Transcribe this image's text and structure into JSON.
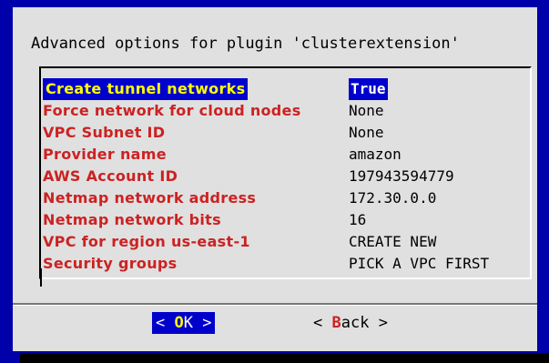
{
  "dialog": {
    "title": "Advanced options for plugin 'clusterextension'"
  },
  "options": [
    {
      "key": "Create tunnel networks",
      "value": "True",
      "selected": true
    },
    {
      "key": "Force network for cloud nodes",
      "value": "None"
    },
    {
      "key": "VPC Subnet ID",
      "value": "None"
    },
    {
      "key": "Provider name",
      "value": "amazon"
    },
    {
      "key": "AWS Account ID",
      "value": "197943594779"
    },
    {
      "key": "Netmap network address",
      "value": "172.30.0.0"
    },
    {
      "key": "Netmap network bits",
      "value": "16"
    },
    {
      "key": "VPC for region us-east-1",
      "value": "CREATE NEW"
    },
    {
      "key": "Security groups",
      "value": "PICK A VPC FIRST"
    }
  ],
  "buttons": {
    "ok": {
      "left": "< ",
      "hot": "O",
      "rest": "K",
      "right": " >"
    },
    "back": {
      "left": "< ",
      "hot": "B",
      "rest": "ack",
      "right": " >"
    }
  },
  "colors": {
    "background": "#0000aa",
    "dialog": "#e0e0e0",
    "option_key": "#cc2222",
    "highlight": "#0000cc",
    "highlight_text": "#ffff00"
  }
}
